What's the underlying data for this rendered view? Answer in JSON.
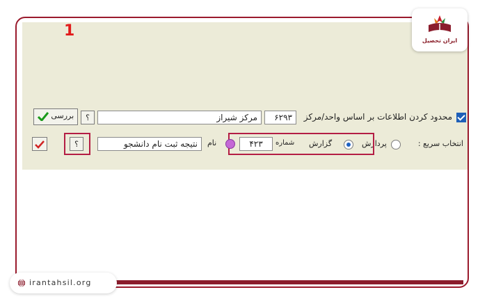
{
  "toolbar": {
    "restrict_label": "محدود کردن اطلاعات بر اساس واحد/مرکز",
    "restrict_checked": true,
    "center_code": "۶۲۹۳",
    "center_name": "مرکز شیراز",
    "help_label": "؟",
    "check_button_label": "بررسی"
  },
  "quick_select": {
    "label": "انتخاب سریع :",
    "options": [
      "پردازش",
      "گزارش"
    ],
    "selected": "گزارش",
    "number_label": "شماره",
    "number_value": "۴۲۳",
    "name_label": "نام",
    "name_value": "نتیجه ثبت نام دانشجو",
    "help_label": "؟"
  },
  "marker": "1",
  "brand": {
    "logo_text": "ایران تحصیل",
    "site": "irantahsil.org",
    "accent": "#8b1c2c"
  }
}
